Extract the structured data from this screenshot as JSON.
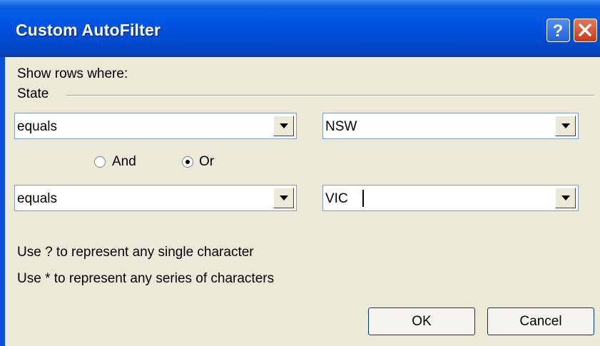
{
  "window": {
    "title": "Custom AutoFilter"
  },
  "dialog": {
    "show_rows_label": "Show rows where:",
    "field_name": "State",
    "criteria1": {
      "operator": "equals",
      "value": "NSW"
    },
    "logic": {
      "and_label": "And",
      "or_label": "Or",
      "selected": "Or"
    },
    "criteria2": {
      "operator": "equals",
      "value": "VIC"
    },
    "hint1": "Use ? to represent any single character",
    "hint2": "Use * to represent any series of characters",
    "ok_label": "OK",
    "cancel_label": "Cancel"
  },
  "colors": {
    "titlebar": "#0054e3",
    "face": "#ece9d8",
    "close_button": "#d4471f"
  }
}
